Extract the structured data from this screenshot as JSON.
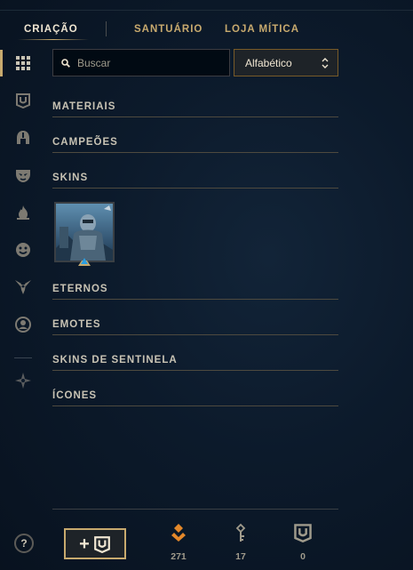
{
  "tabs": [
    {
      "label": "CRIAÇÃO",
      "active": true
    },
    {
      "label": "SANTUÁRIO",
      "active": false
    },
    {
      "label": "LOJA MÍTICA",
      "active": false
    }
  ],
  "sidebar": {
    "items": [
      {
        "icon": "grid-icon",
        "active": true
      },
      {
        "icon": "chest-icon",
        "active": false
      },
      {
        "icon": "helmet-icon",
        "active": false
      },
      {
        "icon": "mask-icon",
        "active": false
      },
      {
        "icon": "flame-icon",
        "active": false
      },
      {
        "icon": "emote-face-icon",
        "active": false
      },
      {
        "icon": "ward-icon",
        "active": false
      },
      {
        "icon": "profile-icon",
        "active": false
      },
      {
        "icon": "crest-icon",
        "active": false
      }
    ]
  },
  "search": {
    "placeholder": "Buscar",
    "value": ""
  },
  "sort": {
    "selected": "Alfabético"
  },
  "sections": [
    {
      "title": "MATERIAIS"
    },
    {
      "title": "CAMPEÕES"
    },
    {
      "title": "SKINS"
    },
    {
      "title": "ETERNOS"
    },
    {
      "title": "EMOTES"
    },
    {
      "title": "SKINS DE SENTINELA"
    },
    {
      "title": "ÍCONES"
    }
  ],
  "skin_card": {
    "rarity_color": "#2d9fe0"
  },
  "footer": {
    "help_label": "?",
    "add_button_plus": "+",
    "currencies": [
      {
        "icon": "orange-essence-icon",
        "count": "271",
        "color": "#e3882a"
      },
      {
        "icon": "key-icon",
        "count": "17",
        "color": "#a09b8c"
      },
      {
        "icon": "chest-icon",
        "count": "0",
        "color": "#a09b8c"
      }
    ]
  },
  "colors": {
    "gold": "#c8aa6e",
    "text_light": "#f0e6d2",
    "background": "#0a1626"
  }
}
